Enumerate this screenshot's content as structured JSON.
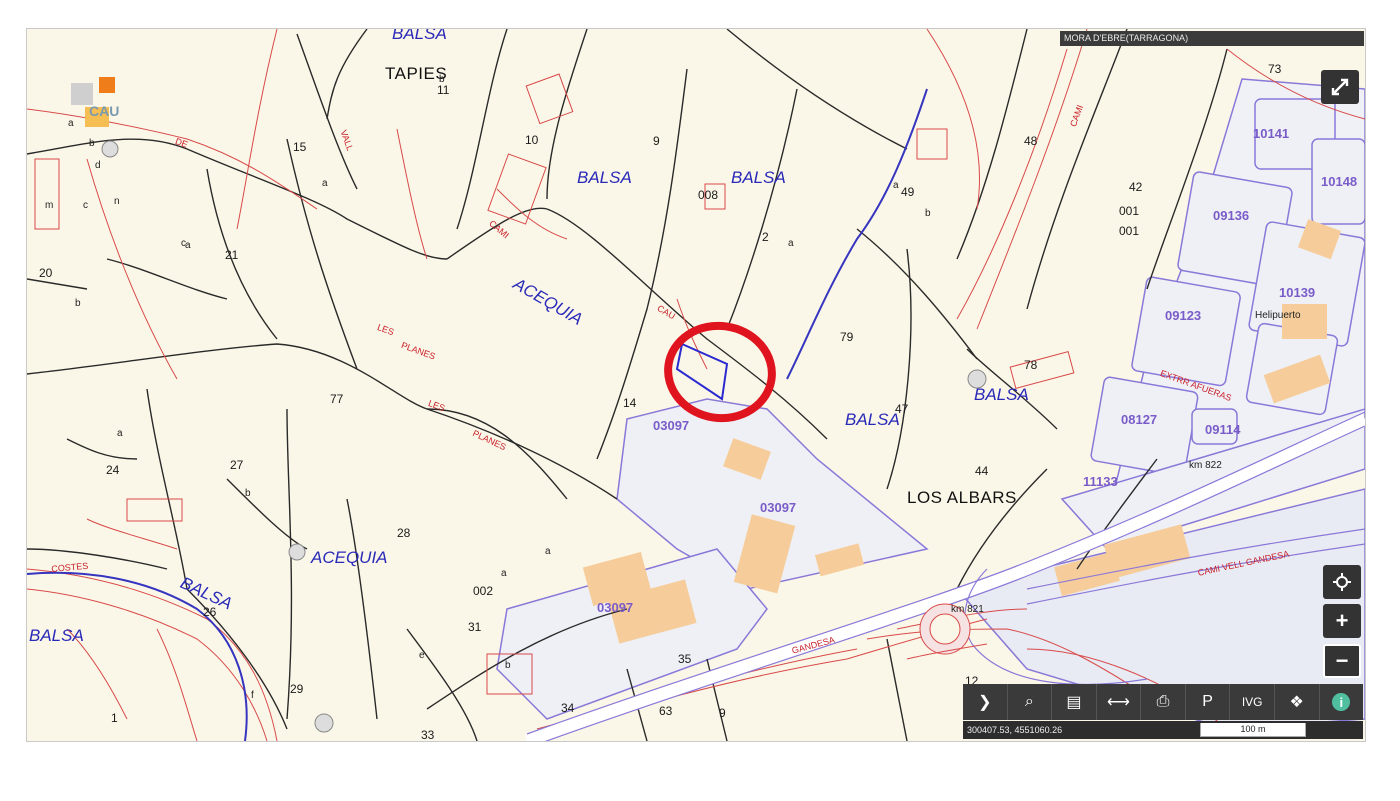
{
  "map": {
    "municipality": "MORA D'EBRE(TARRAGONA)",
    "coordinates": "300407.53, 4551060.26",
    "scale_label": "100 m",
    "logo_text": "CAU",
    "parcel_numbers": [
      "73",
      "15",
      "9",
      "48",
      "49",
      "2",
      "42",
      "001",
      "001",
      "20",
      "21",
      "79",
      "77",
      "14",
      "47",
      "24",
      "27",
      "28",
      "44",
      "26",
      "29",
      "31",
      "35",
      "34",
      "63",
      "9",
      "1",
      "33",
      "10",
      "11",
      "008",
      "002",
      "78",
      "12"
    ],
    "water_labels": [
      "BALSA",
      "BALSA",
      "BALSA",
      "ACEQUIA",
      "BALSA",
      "BALSA",
      "ACEQUIA",
      "BALSA",
      "BALSA"
    ],
    "place_labels": [
      "TAPIES",
      "LOS ALBARS"
    ],
    "zone_codes": [
      "10141",
      "10148",
      "09136",
      "10139",
      "09123",
      "08127",
      "09114",
      "11133",
      "03097",
      "03097",
      "03097"
    ],
    "road_labels": [
      "EXTRR AFUERAS",
      "CAMI VELL GANDESA",
      "GANDESA",
      "COSTES",
      "LES",
      "PLANES",
      "LES",
      "PLANES",
      "CAMI",
      "CAU",
      "CAMI",
      "DE",
      "VALL"
    ],
    "sub_labels": [
      "a",
      "b",
      "c",
      "d",
      "e",
      "f",
      "m",
      "n",
      "a",
      "b",
      "a",
      "b",
      "c",
      "a",
      "b",
      "a",
      "a",
      "b",
      "a",
      "a",
      "b"
    ],
    "small_labels": [
      "Helipuerto",
      "km 822",
      "km 821"
    ]
  },
  "controls": {
    "fullscreen_icon": "expand-icon",
    "locate_icon": "crosshair-icon",
    "zoom_in": "+",
    "zoom_out": "−"
  },
  "toolbar": {
    "items": [
      {
        "icon": "chevron-right-icon",
        "glyph": "❯"
      },
      {
        "icon": "search-icon",
        "glyph": "⌕"
      },
      {
        "icon": "layers-icon",
        "glyph": "▤"
      },
      {
        "icon": "measure-icon",
        "glyph": "⟷"
      },
      {
        "icon": "print-icon",
        "glyph": "⎙"
      },
      {
        "icon": "parcel-icon",
        "glyph": "P"
      },
      {
        "icon": "ivg-icon",
        "glyph": "IVG"
      },
      {
        "icon": "basemap-icon",
        "glyph": "❖"
      },
      {
        "icon": "info-icon",
        "glyph": "i"
      }
    ]
  },
  "colors": {
    "map_background": "#fbf7e8",
    "parcel_line": "#222222",
    "red_line": "#d04040",
    "water_blue": "#3535c0",
    "zone_purple": "#8a78d8",
    "building": "#f6cd9a",
    "highlight_circle": "#e0141e",
    "toolbar": "#3a3a3a"
  }
}
